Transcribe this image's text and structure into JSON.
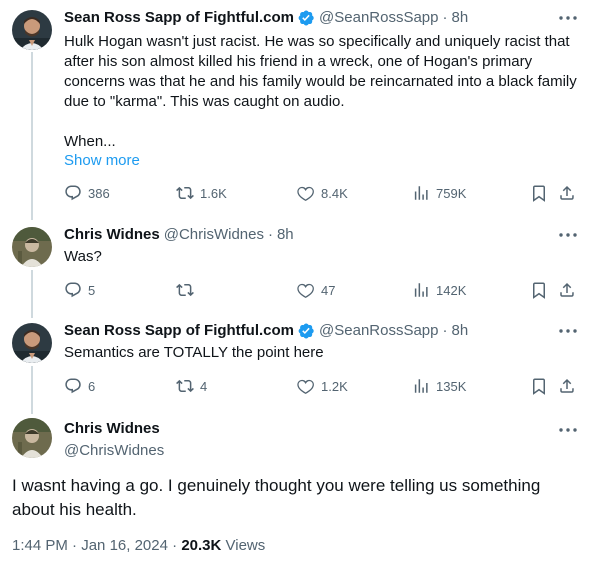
{
  "tweets": [
    {
      "name": "Sean Ross Sapp of Fightful.com",
      "handle": "@SeanRossSapp",
      "dot": "·",
      "time": "8h",
      "text": "Hulk Hogan wasn't just racist. He was so specifically and uniquely racist that after his son almost killed his friend in a wreck, one of Hogan's primary concerns was that he and his family would be reincarnated into a black family due to \"karma\". This was caught on audio.",
      "text2": "When...",
      "show_more": "Show more",
      "replies": "386",
      "reposts": "1.6K",
      "likes": "8.4K",
      "views": "759K"
    },
    {
      "name": "Chris Widnes",
      "handle": "@ChrisWidnes",
      "dot": "·",
      "time": "8h",
      "text": "Was?",
      "replies": "5",
      "reposts": "",
      "likes": "47",
      "views": "142K"
    },
    {
      "name": "Sean Ross Sapp of Fightful.com",
      "handle": "@SeanRossSapp",
      "dot": "·",
      "time": "8h",
      "text": "Semantics are TOTALLY the point here",
      "replies": "6",
      "reposts": "4",
      "likes": "1.2K",
      "views": "135K"
    }
  ],
  "main_tweet": {
    "name": "Chris Widnes",
    "handle": "@ChrisWidnes",
    "text": "I wasnt having a go. I genuinely thought you were telling us something about his health.",
    "time": "1:44 PM",
    "dot": "·",
    "date": "Jan 16, 2024",
    "views_count": "20.3K",
    "views_label": "Views"
  },
  "icons": {
    "verified": "verified-badge-icon",
    "more": "more-icon",
    "reply": "reply-icon",
    "repost": "repost-icon",
    "like": "like-icon",
    "views": "views-icon",
    "bookmark": "bookmark-icon",
    "share": "share-icon"
  },
  "colors": {
    "text": "#0f1419",
    "secondary": "#536471",
    "accent": "#1d9bf0",
    "thread_line": "#cfd9de"
  }
}
